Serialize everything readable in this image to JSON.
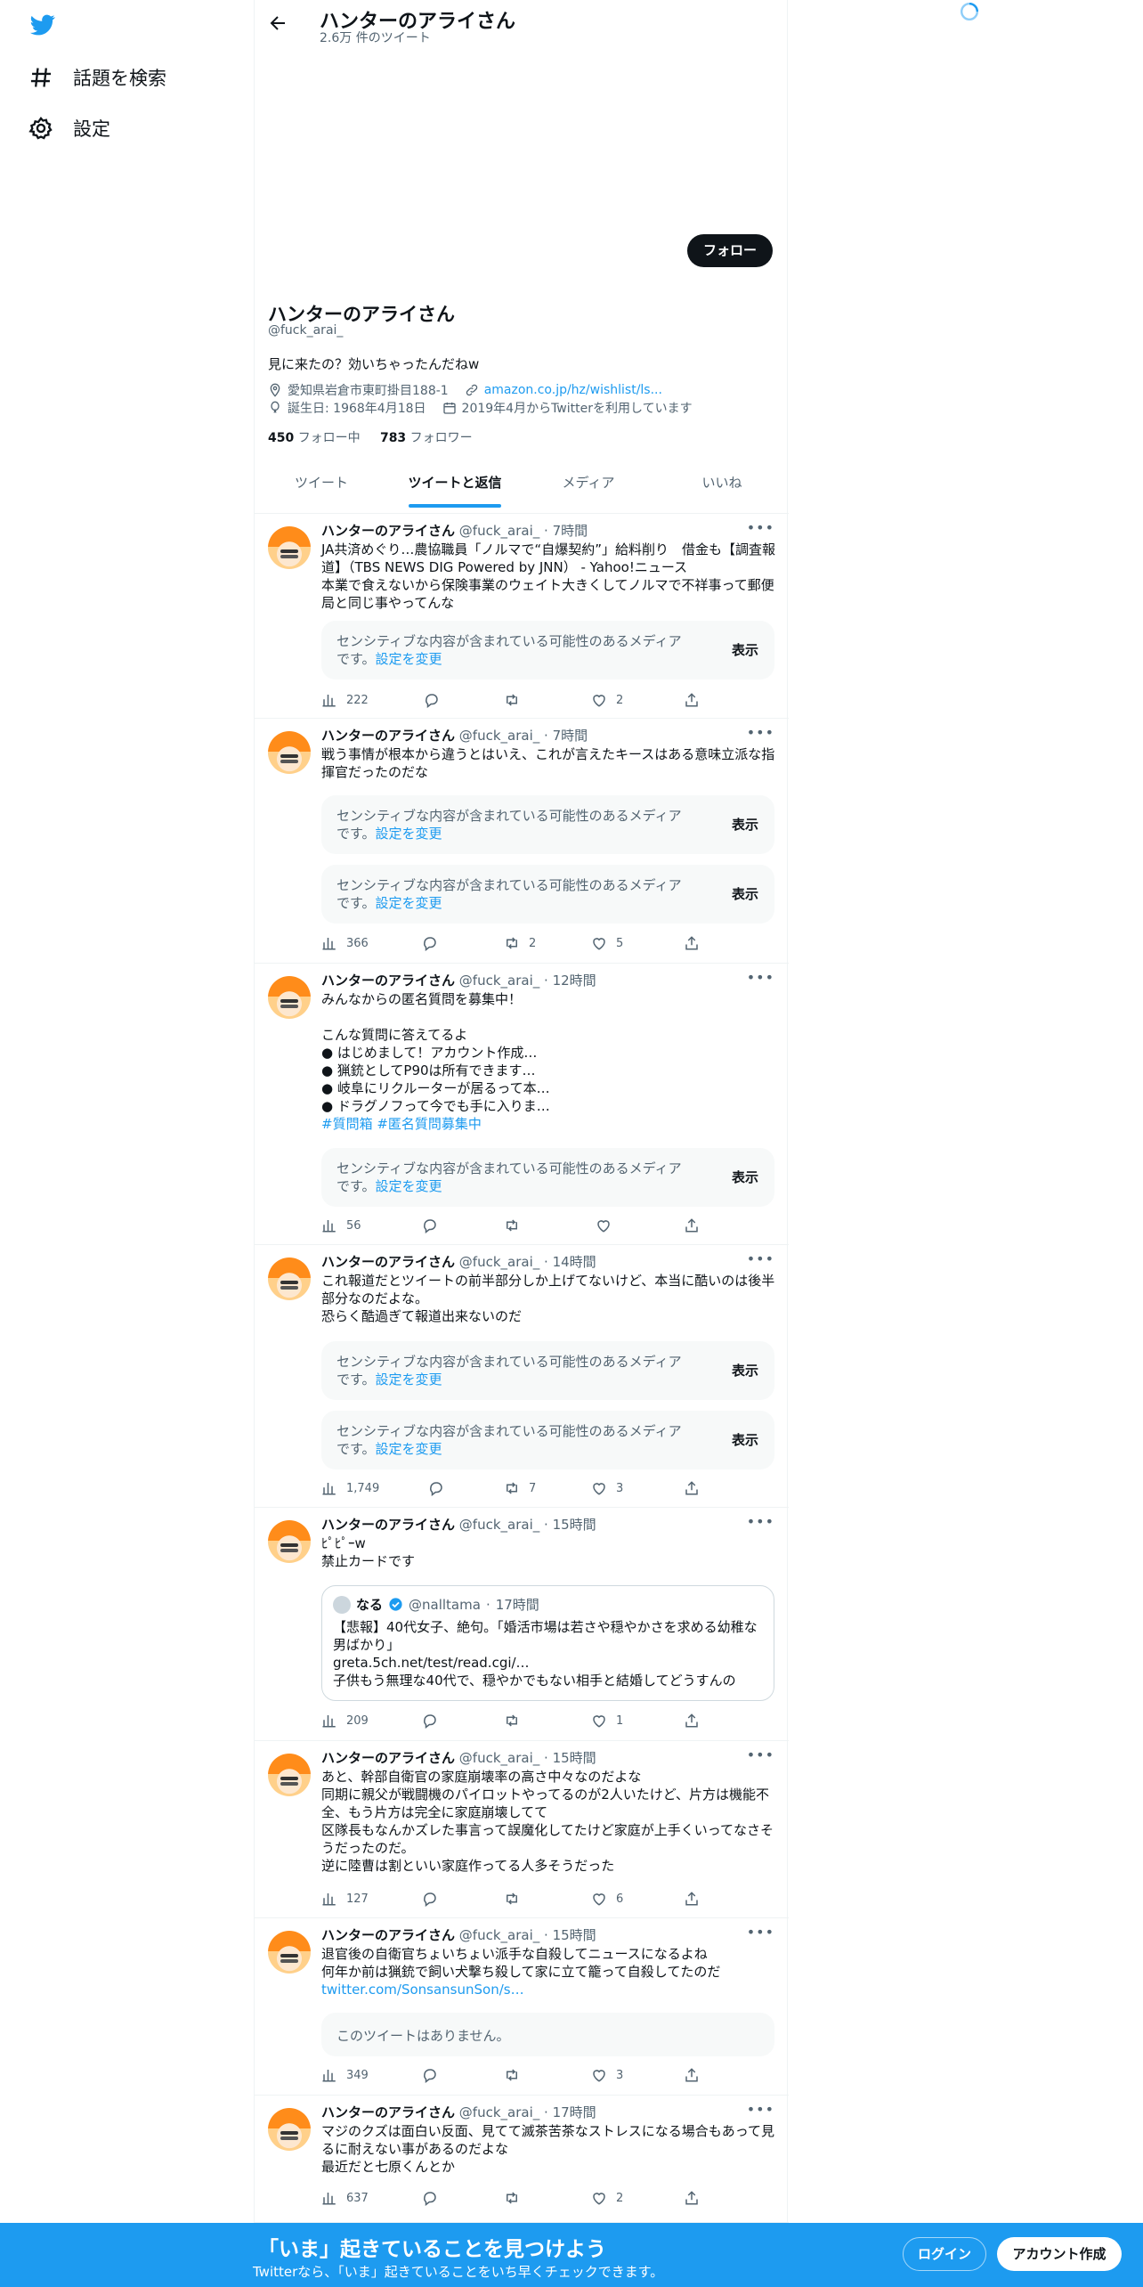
{
  "sidebar": {
    "items": [
      {
        "label": "話題を検索",
        "icon": "hashtag-icon"
      },
      {
        "label": "設定",
        "icon": "gear-icon"
      }
    ]
  },
  "header": {
    "title": "ハンターのアライさん",
    "subtitle": "2.6万 件のツイート"
  },
  "profile": {
    "follow_label": "フォロー",
    "name": "ハンターのアライさん",
    "handle": "@fuck_arai_",
    "bio": "見に来たの？効いちゃったんだねw",
    "location": "愛知県岩倉市東町掛目188-1",
    "link": "amazon.co.jp/hz/wishlist/ls...",
    "birthday": "誕生日: 1968年4月18日",
    "joined": "2019年4月からTwitterを利用しています",
    "following_count": "450",
    "following_label": "フォロー中",
    "followers_count": "783",
    "followers_label": "フォロワー"
  },
  "tabs": [
    {
      "label": "ツイート",
      "active": false
    },
    {
      "label": "ツイートと返信",
      "active": true
    },
    {
      "label": "メディア",
      "active": false
    },
    {
      "label": "いいね",
      "active": false
    }
  ],
  "sensitive": {
    "text": "センシティブな内容が含まれている可能性のあるメディアです。",
    "link": "設定を変更",
    "show": "表示"
  },
  "tweets": [
    {
      "name": "ハンターのアライさん",
      "handle": "@fuck_arai_",
      "time": "7時間",
      "body": "JA共済めぐり…農協職員「ノルマで“自爆契約”」給料削り　借金も【調査報道】（TBS NEWS DIG Powered by JNN） - Yahoo!ニュース\n本業で食えないから保険事業のウェイト大きくしてノルマで不祥事って郵便局と同じ事やってんな",
      "views": "222",
      "replies": "",
      "retweets": "",
      "likes": "2"
    },
    {
      "name": "ハンターのアライさん",
      "handle": "@fuck_arai_",
      "time": "7時間",
      "body": "戦う事情が根本から違うとはいえ、これが言えたキースはある意味立派な指揮官だったのだな",
      "views": "366",
      "replies": "",
      "retweets": "2",
      "likes": "5"
    },
    {
      "name": "ハンターのアライさん",
      "handle": "@fuck_arai_",
      "time": "12時間",
      "body": "みんなからの匿名質問を募集中！\n\nこんな質問に答えてるよ\n● はじめまして！アカウント作成…\n● 猟銃としてP90は所有できます…\n● 岐阜にリクルーターが居るって本…\n● ドラグノフって今でも手に入りま…",
      "hashtags": "#質問箱 #匿名質問募集中",
      "views": "56",
      "replies": "",
      "retweets": "",
      "likes": ""
    },
    {
      "name": "ハンターのアライさん",
      "handle": "@fuck_arai_",
      "time": "14時間",
      "body": "これ報道だとツイートの前半部分しか上げてないけど、本当に酷いのは後半部分なのだよな。\n恐らく酷過ぎて報道出来ないのだ",
      "views": "1,749",
      "replies": "",
      "retweets": "7",
      "likes": "3"
    },
    {
      "name": "ハンターのアライさん",
      "handle": "@fuck_arai_",
      "time": "15時間",
      "body": "ﾋﾟﾋﾟｰw\n禁止カードです",
      "quote": {
        "name": "なる",
        "handle": "@nalltama",
        "time": "17時間",
        "body": "【悲報】40代女子、絶句。「婚活市場は若さや穏やかさを求める幼稚な男ばかり」\ngreta.5ch.net/test/read.cgi/…\n子供もう無理な40代で、穏やかでもない相手と結婚してどうすんの"
      },
      "views": "209",
      "replies": "",
      "retweets": "",
      "likes": "1"
    },
    {
      "name": "ハンターのアライさん",
      "handle": "@fuck_arai_",
      "time": "15時間",
      "body": "あと、幹部自衛官の家庭崩壊率の高さ中々なのだよな\n同期に親父が戦闘機のパイロットやってるのが2人いたけど、片方は機能不全、もう片方は完全に家庭崩壊してて\n区隊長もなんかズレた事言って誤魔化してたけど家庭が上手くいってなさそうだったのだ。\n逆に陸曹は割といい家庭作ってる人多そうだった",
      "views": "127",
      "replies": "",
      "retweets": "",
      "likes": "6"
    },
    {
      "name": "ハンターのアライさん",
      "handle": "@fuck_arai_",
      "time": "15時間",
      "body": "退官後の自衛官ちょいちょい派手な自殺してニュースになるよね\n何年か前は猟銃で飼い犬撃ち殺して家に立て籠って自殺してたのだ",
      "link": "twitter.com/SonsansunSon/s…",
      "unavailable": "このツイートはありません。",
      "views": "349",
      "replies": "",
      "retweets": "",
      "likes": "3"
    },
    {
      "name": "ハンターのアライさん",
      "handle": "@fuck_arai_",
      "time": "17時間",
      "body": "マジのクズは面白い反面、見てて滅茶苦茶なストレスになる場合もあって見るに耐えない事があるのだよな\n最近だと七原くんとか",
      "views": "637",
      "replies": "",
      "retweets": "",
      "likes": "2"
    }
  ],
  "bottom_bar": {
    "title": "「いま」起きていることを見つけよう",
    "subtitle": "Twitterなら、「いま」起きていることをいち早くチェックできます。",
    "login": "ログイン",
    "signup": "アカウント作成"
  },
  "colors": {
    "accent": "#1d9bf0",
    "text": "#0f1419",
    "muted": "#536471",
    "verified": "#1d9bf0"
  }
}
